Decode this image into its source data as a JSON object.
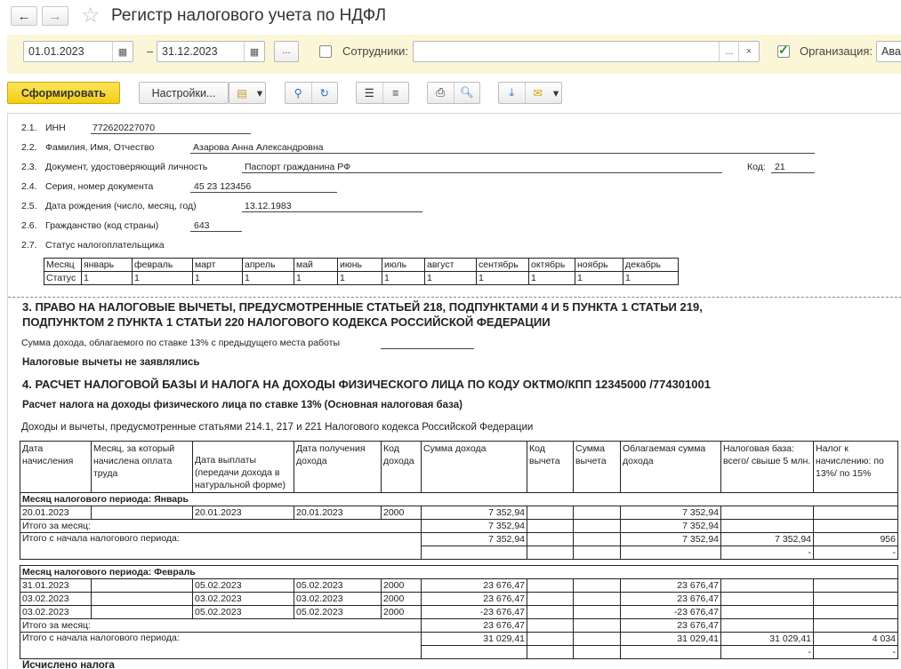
{
  "window": {
    "title": "Регистр налогового учета по НДФЛ",
    "back_icon": "←",
    "fwd_icon": "→"
  },
  "filters": {
    "date_from": "01.01.2023",
    "date_to": "31.12.2023",
    "dash": "–",
    "period_btn": "...",
    "employees_label": "Сотрудники:",
    "employees_value": "",
    "employees_pick": "...",
    "employees_clear": "×",
    "organization_label": "Организация:",
    "organization_value": "Ава"
  },
  "toolbar": {
    "generate": "Сформировать",
    "settings": "Настройки..."
  },
  "person": {
    "inn_num": "2.1.",
    "inn_label": "ИНН",
    "inn_value": "772620227070",
    "fio_num": "2.2.",
    "fio_label": "Фамилия, Имя, Отчество",
    "fio_value": "Азарова Анна Александровна",
    "doc_num": "2.3.",
    "doc_label": "Документ, удостоверяющий личность",
    "doc_value": "Паспорт гражданина РФ",
    "code_label": "Код:",
    "code_value": "21",
    "series_num": "2.4.",
    "series_label": "Серия, номер документа",
    "series_value": "45 23 123456",
    "birth_num": "2.5.",
    "birth_label": "Дата рождения (число, месяц, год)",
    "birth_value": "13.12.1983",
    "citizen_num": "2.6.",
    "citizen_label": "Гражданство (код страны)",
    "citizen_value": "643",
    "status_num": "2.7.",
    "status_label": "Статус налогоплательщика"
  },
  "status_table": {
    "row1_label": "Месяц",
    "row2_label": "Статус",
    "months": [
      "январь",
      "февраль",
      "март",
      "апрель",
      "май",
      "июнь",
      "июль",
      "август",
      "сентябрь",
      "октябрь",
      "ноябрь",
      "декабрь"
    ],
    "values": [
      "1",
      "1",
      "1",
      "1",
      "1",
      "1",
      "1",
      "1",
      "1",
      "1",
      "1",
      "1"
    ]
  },
  "section3": {
    "title1": "3. ПРАВО НА НАЛОГОВЫЕ ВЫЧЕТЫ, ПРЕДУСМОТРЕННЫЕ СТАТЬЕЙ  218, ПОДПУНКТАМИ 4 И 5 ПУНКТА 1 СТАТЬИ 219,",
    "title2": "ПОДПУНКТОМ 2 ПУНКТА 1 СТАТЬИ 220 НАЛОГОВОГО КОДЕКСА РОССИЙСКОЙ ФЕДЕРАЦИИ",
    "prev_income": "Сумма дохода, облагаемого по ставке 13% с предыдущего места работы",
    "no_deductions": "Налоговые вычеты не заявлялись"
  },
  "section4": {
    "title": "4. РАСЧЕТ НАЛОГОВОЙ БАЗЫ И НАЛОГА НА ДОХОДЫ ФИЗИЧЕСКОГО ЛИЦА ПО КОДУ ОКТМО/КПП 12345000   /774301001",
    "subtitle": "Расчет налога на доходы физического лица по ставке 13% (Основная налоговая база)",
    "caption": "Доходы и вычеты, предусмотренные статьями 214.1, 217 и 221 Налогового кодекса Российской Федерации",
    "headers": [
      "Дата начисления",
      "Месяц, за который начислена оплата труда",
      "Дата выплаты (передачи дохода в натуральной форме)",
      "Дата получения дохода",
      "Код дохода",
      "Сумма дохода",
      "Код вычета",
      "Сумма вычета",
      "Облагаемая сумма дохода",
      "Налоговая база: всего/ свыше 5 млн.",
      "Налог к начислению: по 13%/ по 15%"
    ],
    "jan_title": "Месяц налогового периода: Январь",
    "jan_row": [
      "20.01.2023",
      "",
      "20.01.2023",
      "20.01.2023",
      "2000",
      "7 352,94",
      "",
      "",
      "7 352,94",
      "",
      ""
    ],
    "jan_month_label": "Итого за месяц:",
    "jan_month_income": "7 352,94",
    "jan_month_taxable": "7 352,94",
    "jan_ytd_label": "Итого с начала налогового периода:",
    "jan_ytd_income": "7 352,94",
    "jan_ytd_taxable": "7 352,94",
    "jan_ytd_base": "7 352,94",
    "jan_ytd_tax": "956",
    "jan_ytd_base2": "-",
    "jan_ytd_tax2": "-",
    "feb_title": "Месяц налогового периода: Февраль",
    "feb_rows": [
      [
        "31.01.2023",
        "",
        "05.02.2023",
        "05.02.2023",
        "2000",
        "23 676,47",
        "",
        "",
        "23 676,47",
        "",
        ""
      ],
      [
        "03.02.2023",
        "",
        "03.02.2023",
        "03.02.2023",
        "2000",
        "23 676,47",
        "",
        "",
        "23 676,47",
        "",
        ""
      ],
      [
        "03.02.2023",
        "",
        "05.02.2023",
        "05.02.2023",
        "2000",
        "-23 676,47",
        "",
        "",
        "-23 676,47",
        "",
        ""
      ]
    ],
    "feb_month_label": "Итого за месяц:",
    "feb_month_income": "23 676,47",
    "feb_month_taxable": "23 676,47",
    "feb_ytd_label": "Итого с начала налогового периода:",
    "feb_ytd_income": "31 029,41",
    "feb_ytd_taxable": "31 029,41",
    "feb_ytd_base": "31 029,41",
    "feb_ytd_tax": "4 034",
    "feb_ytd_base2": "-",
    "feb_ytd_tax2": "-",
    "calculated_label": "Исчислено налога"
  }
}
